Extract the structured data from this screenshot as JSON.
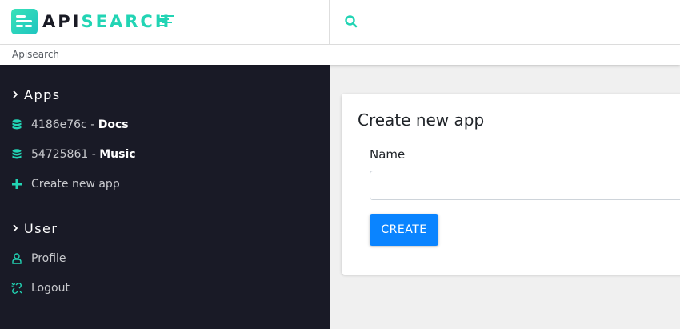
{
  "header": {
    "logo": {
      "part1": "API",
      "part2": "SEARCH",
      "icon": "apisearch-logo-icon"
    },
    "search": {
      "icon": "search-icon"
    }
  },
  "breadcrumb": {
    "label": "Apisearch"
  },
  "sidebar": {
    "sections": [
      {
        "title": "Apps",
        "items": [
          {
            "icon": "database-icon",
            "id": "4186e76c",
            "sep": " - ",
            "name": "Docs"
          },
          {
            "icon": "database-icon",
            "id": "54725861",
            "sep": " - ",
            "name": "Music"
          },
          {
            "icon": "plus-icon",
            "label": "Create new app"
          }
        ]
      },
      {
        "title": "User",
        "items": [
          {
            "icon": "user-icon",
            "label": "Profile"
          },
          {
            "icon": "unlink-icon",
            "label": "Logout"
          }
        ]
      }
    ]
  },
  "main": {
    "card": {
      "title": "Create new app",
      "name_label": "Name",
      "name_value": "",
      "create_label": "CREATE"
    }
  },
  "colors": {
    "accent": "#22d4b4",
    "sidebar_bg": "#191a26",
    "primary_button": "#0a84ff",
    "content_bg": "#f0f0f0"
  }
}
